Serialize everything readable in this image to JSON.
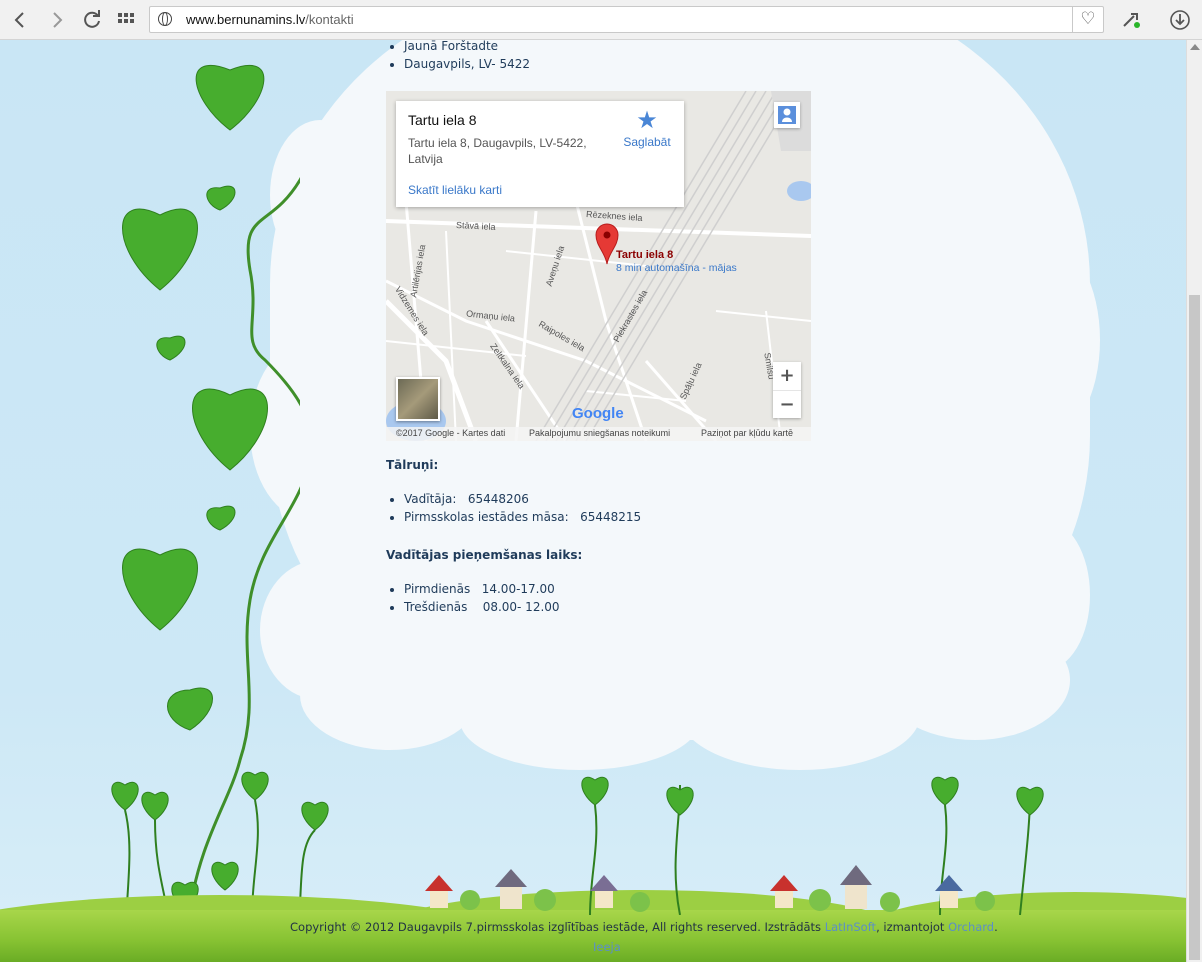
{
  "browser": {
    "url_domain": "www.bernunamins.lv",
    "url_path": "/kontakti"
  },
  "address": {
    "items": [
      "Jaunā Forštadte",
      "Daugavpils, LV- 5422"
    ]
  },
  "map": {
    "place_title": "Tartu iela 8",
    "place_address_line1": "Tartu iela 8, Daugavpils, LV-5422,",
    "place_address_line2": "Latvija",
    "save_label": "Saglabāt",
    "larger_map_link": "Skatīt lielāku karti",
    "pin_label": "Tartu iela 8",
    "pin_sublabel": "8 min automašīna - mājas",
    "zoom_in": "+",
    "zoom_out": "−",
    "google_logo": "Google",
    "attribution": "©2017 Google - Kartes dati",
    "terms": "Pakalpojumu sniegšanas noteikumi",
    "report": "Paziņot par kļūdu kartē",
    "streets": [
      "Rēzeknes iela",
      "Stāvā iela",
      "Artilērijas iela",
      "Aveņu iela",
      "Ormaņu iela",
      "Raipoles iela",
      "Piekrastes iela",
      "Vidzemes iela",
      "Zeltkalna iela",
      "Spāļu iela",
      "Smilšu"
    ]
  },
  "phones": {
    "heading": "Tālruņi:",
    "items": [
      {
        "label": "Vadītāja:",
        "value": "65448206"
      },
      {
        "label": "Pirmsskolas iestādes māsa:",
        "value": "65448215"
      }
    ]
  },
  "hours": {
    "heading": "Vadītājas pieņemšanas laiks:",
    "items": [
      {
        "label": "Pirmdienās",
        "value": "14.00-17.00"
      },
      {
        "label": "Trešdienās",
        "value": "08.00- 12.00"
      }
    ]
  },
  "footer": {
    "copyright": "Copyright © 2012 Daugavpils 7.pirmsskolas izglītības iestāde, All rights reserved. Izstrādāts",
    "developer": "LatInSoft",
    "using": ", izmantojot",
    "cms": "Orchard",
    "period": ".",
    "login": "Ieeja"
  },
  "colors": {
    "text": "#1f3b5a",
    "link": "#5b8fc7",
    "pin": "#d32f2f",
    "leaf": "#3fa32a"
  }
}
